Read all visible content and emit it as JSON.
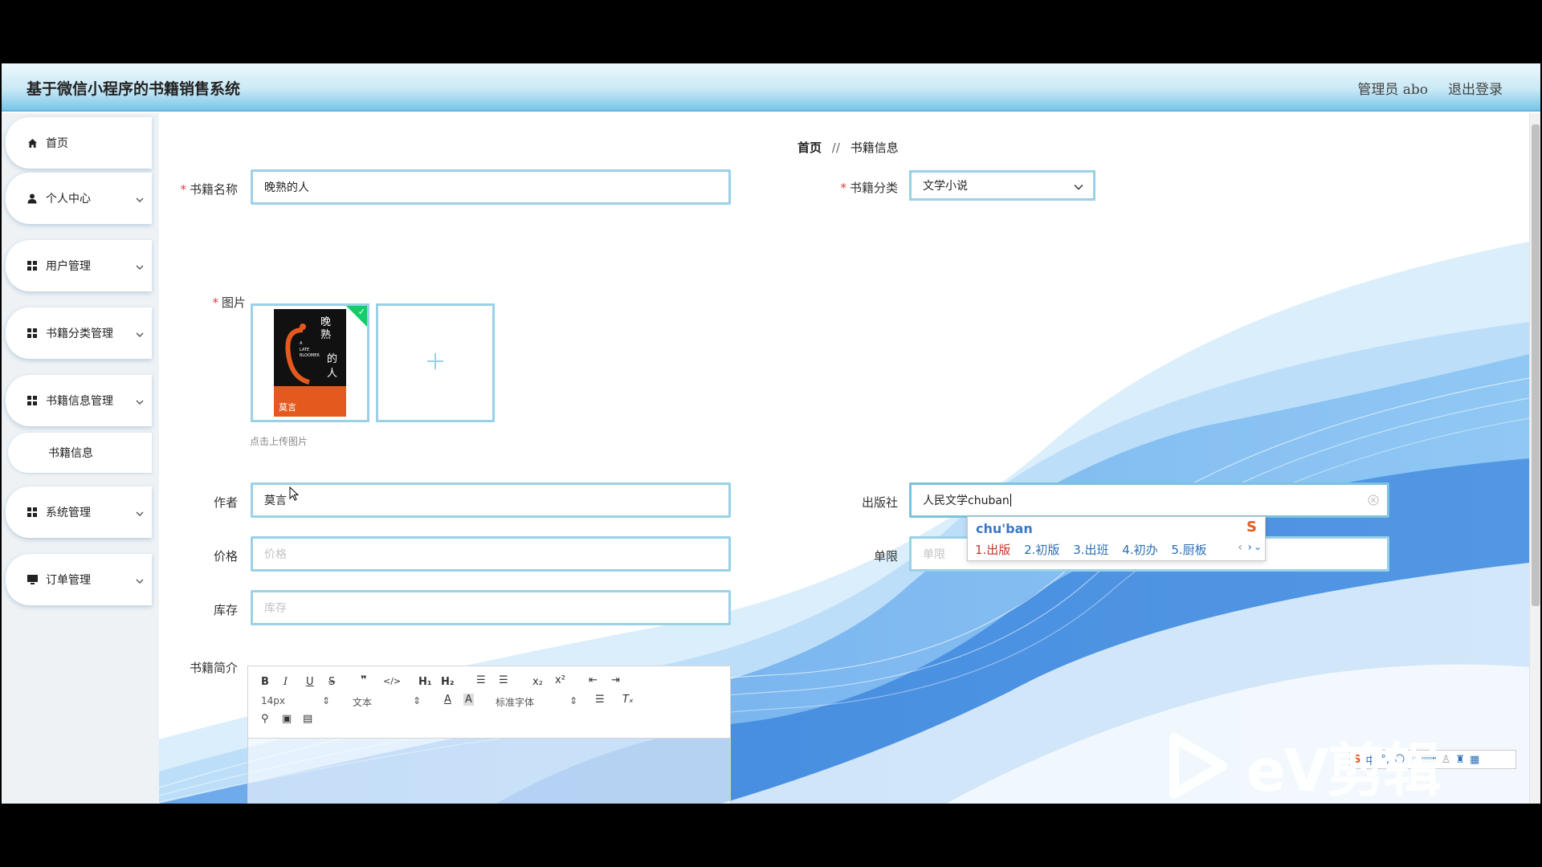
{
  "header": {
    "app_title": "基于微信小程序的书籍销售系统",
    "user_label": "管理员 abo",
    "logout_label": "退出登录"
  },
  "sidebar": {
    "items": [
      {
        "label": "首页",
        "icon": "home-icon"
      },
      {
        "label": "个人中心",
        "icon": "user-icon"
      },
      {
        "label": "用户管理",
        "icon": "grid-icon"
      },
      {
        "label": "书籍分类管理",
        "icon": "grid-icon"
      },
      {
        "label": "书籍信息管理",
        "icon": "grid-icon"
      },
      {
        "label": "系统管理",
        "icon": "grid-icon"
      },
      {
        "label": "订单管理",
        "icon": "monitor-icon"
      }
    ],
    "sub_item": "书籍信息"
  },
  "breadcrumb": {
    "home": "首页",
    "separator": "//",
    "current": "书籍信息"
  },
  "form": {
    "book_name": {
      "label": "书籍名称",
      "value": "晚熟的人"
    },
    "category": {
      "label": "书籍分类",
      "value": "文学小说"
    },
    "image": {
      "label": "图片",
      "hint": "点击上传图片",
      "cover": {
        "title": "晚熟的人",
        "english": "A LATE BLOOMER",
        "author": "莫言"
      }
    },
    "author": {
      "label": "作者",
      "value": "莫言"
    },
    "publisher": {
      "label": "出版社",
      "value": "人民文学chuban"
    },
    "price": {
      "label": "价格",
      "placeholder": "价格"
    },
    "unit": {
      "label": "单限",
      "placeholder": "单限"
    },
    "stock": {
      "label": "库存",
      "placeholder": "库存"
    },
    "intro": {
      "label": "书籍简介"
    }
  },
  "editor": {
    "font_size": "14px",
    "block_type": "文本",
    "font_family": "标准字体"
  },
  "ime": {
    "composition": "chu'ban",
    "candidates": [
      "1.出版",
      "2.初版",
      "3.出班",
      "4.初办",
      "5.厨板"
    ]
  },
  "ime_bar": {
    "lang": "中"
  },
  "watermark": "eV剪辑",
  "colors": {
    "accent": "#9ad1e6",
    "header_bottom": "#79c6e8",
    "required": "#e4393c"
  }
}
